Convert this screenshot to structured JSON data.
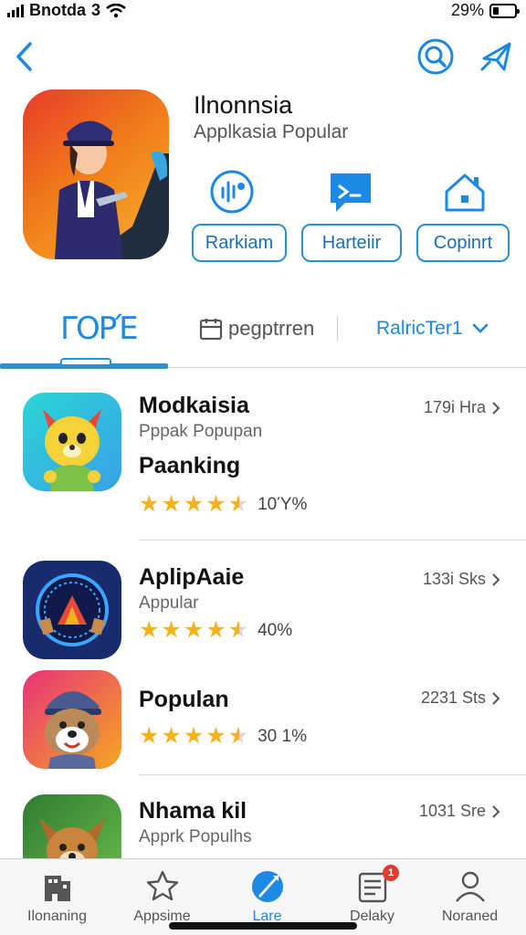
{
  "status_bar": {
    "carrier": "Bnotda",
    "network": "3",
    "battery_percent_text": "29%",
    "battery_level": 0.29
  },
  "nav": {
    "back_icon": "chevron-left-icon",
    "search_icon": "search-icon",
    "share_icon": "share-icon"
  },
  "app": {
    "title": "Ilnonnsia",
    "subtitle": "Applkasia Popular",
    "actions": [
      {
        "label": "Rarkiam",
        "icon": "podcast-icon"
      },
      {
        "label": "Harteiir",
        "icon": "message-icon"
      },
      {
        "label": "Copinrt",
        "icon": "home-icon"
      }
    ]
  },
  "tabs": {
    "active_label": "ΓΟΡΈ",
    "second_label": "pegptrren",
    "third_label": "RalricTer1"
  },
  "list": [
    {
      "title": "Modkaisia",
      "subtitle": "Pppak Popupan",
      "extra": "Paanking",
      "meta": "179i Hra",
      "rating": 4.5,
      "rating_text": "10Ύ%"
    },
    {
      "title": "AplipAaie",
      "subtitle": "Appular",
      "extra": "",
      "meta": "133i Sks",
      "rating": 4.5,
      "rating_text": "40%"
    },
    {
      "title": "Populan",
      "subtitle": "",
      "extra": "",
      "meta": "2231 Sts",
      "rating": 4.5,
      "rating_text": "30 1%"
    },
    {
      "title": "Nhama kil",
      "subtitle": "Apprk Populhs",
      "extra": "",
      "meta": "1031 Sre",
      "rating": 0,
      "rating_text": ""
    }
  ],
  "tab_bar": [
    {
      "label": "Ilonaning",
      "icon": "building-icon",
      "active": false
    },
    {
      "label": "Appsime",
      "icon": "star-icon",
      "active": false
    },
    {
      "label": "Lare",
      "icon": "rocket-icon",
      "active": true
    },
    {
      "label": "Delaky",
      "icon": "updates-icon",
      "active": false,
      "badge": "1"
    },
    {
      "label": "Noraned",
      "icon": "person-icon",
      "active": false
    }
  ],
  "colors": {
    "accent": "#1e88e5",
    "star": "#f5b21b",
    "badge": "#e53935"
  }
}
